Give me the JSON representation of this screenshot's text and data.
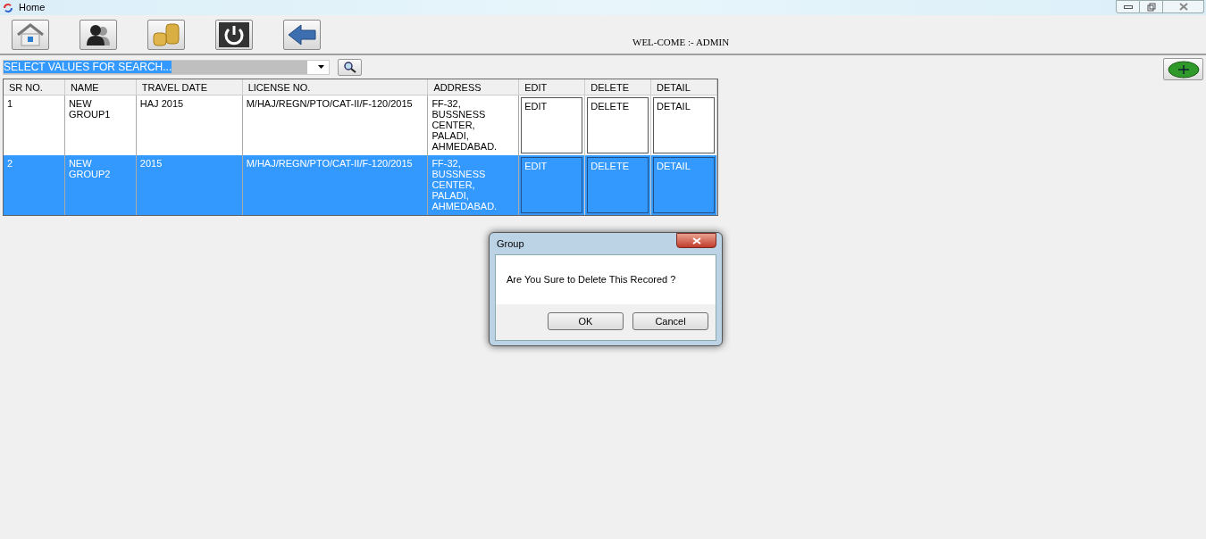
{
  "window": {
    "title": "Home"
  },
  "welcome": "WEL-COME :- ADMIN",
  "search": {
    "value": "SELECT VALUES FOR SEARCH..."
  },
  "table": {
    "columns": [
      "SR NO.",
      "NAME",
      "TRAVEL DATE",
      "LICENSE NO.",
      "ADDRESS",
      "EDIT",
      "DELETE",
      "DETAIL"
    ],
    "rows": [
      {
        "selected": false,
        "cells": [
          "1",
          "NEW GROUP1",
          "HAJ 2015",
          "M/HAJ/REGN/PTO/CAT-II/F-120/2015",
          "FF-32, BUSSNESS CENTER, PALADI, AHMEDABAD.",
          "EDIT",
          "DELETE",
          "DETAIL"
        ]
      },
      {
        "selected": true,
        "cells": [
          "2",
          "NEW GROUP2",
          "2015",
          "M/HAJ/REGN/PTO/CAT-II/F-120/2015",
          "FF-32, BUSSNESS CENTER, PALADI, AHMEDABAD.",
          "EDIT",
          "DELETE",
          "DETAIL"
        ]
      }
    ]
  },
  "dialog": {
    "title": "Group",
    "message": "Are You Sure to Delete This Recored ?",
    "buttons": [
      "OK",
      "Cancel"
    ]
  }
}
